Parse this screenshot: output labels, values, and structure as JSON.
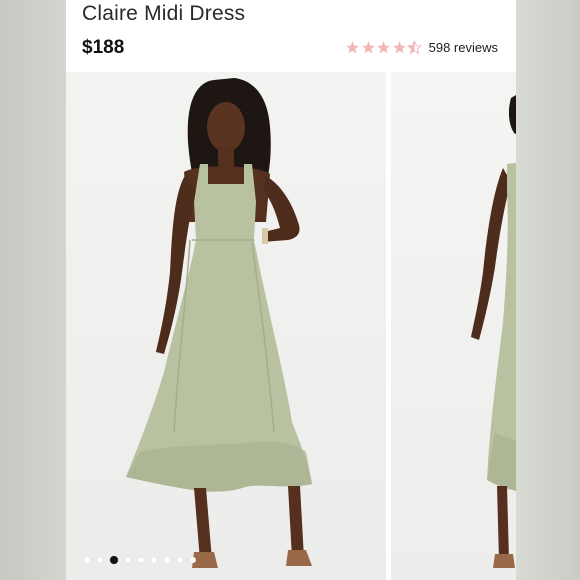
{
  "product": {
    "title": "Claire Midi Dress",
    "price": "$188",
    "rating": {
      "stars": 4.5,
      "max": 5,
      "color": "#f1b8b8",
      "reviews_label": "598 reviews"
    }
  },
  "gallery": {
    "slides": [
      {
        "label": "model-front-view"
      },
      {
        "label": "model-side-view"
      }
    ],
    "dots": {
      "count": 9,
      "active_index": 2
    }
  },
  "colors": {
    "dress": "#b9c2a0",
    "background": "#f0f0ee"
  }
}
